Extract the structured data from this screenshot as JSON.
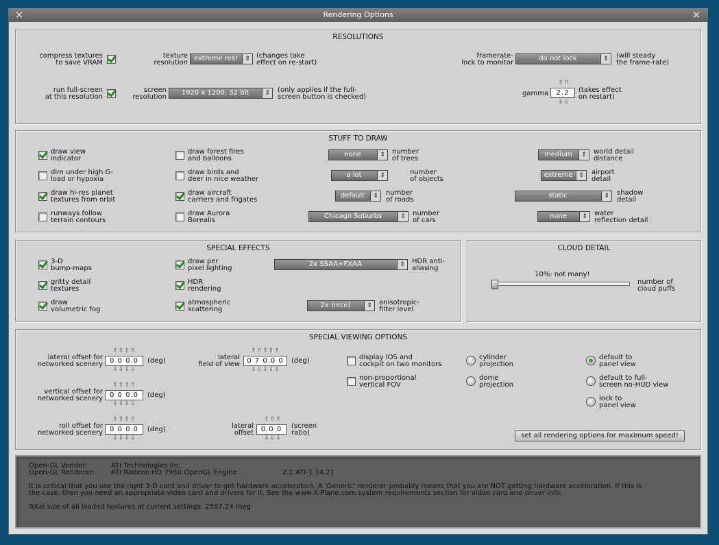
{
  "window": {
    "title": "Rendering Options",
    "close_glyph": "✕"
  },
  "resolutions": {
    "title": "RESOLUTIONS",
    "compress_textures": {
      "label1": "compress textures",
      "label2": "to save VRAM",
      "checked": true
    },
    "texture_resolution": {
      "label1": "texture",
      "label2": "resolution",
      "value": "extreme res!",
      "note1": "(changes take",
      "note2": "effect on re-start)"
    },
    "framerate_lock": {
      "label1": "framerate-",
      "label2": "lock to monitor",
      "value": "do not lock",
      "note1": "(will steady",
      "note2": "the frame-rate)"
    },
    "run_fullscreen": {
      "label1": "run full-screen",
      "label2": "at this resolution",
      "checked": true
    },
    "screen_resolution": {
      "label1": "screen",
      "label2": "resolution",
      "value": "1920 x 1200, 32 bit",
      "note1": "(only applies if the full-",
      "note2": "screen button is checked)"
    },
    "gamma": {
      "label": "gamma",
      "value": "2.2",
      "note1": "(takes effect",
      "note2": "on restart)"
    }
  },
  "stuff": {
    "title": "STUFF TO DRAW",
    "draw_view_indicator": {
      "l1": "draw view",
      "l2": "indicator",
      "checked": true
    },
    "dim_under_g": {
      "l1": "dim under high G-",
      "l2": "load or hypoxia",
      "checked": false
    },
    "draw_hires_planet": {
      "l1": "draw hi-res planet",
      "l2": "textures from orbit",
      "checked": true
    },
    "runways_follow": {
      "l1": "runways follow",
      "l2": "terrain contours",
      "checked": false
    },
    "draw_forest_fires": {
      "l1": "draw forest fires",
      "l2": "and balloons",
      "checked": false
    },
    "draw_birds": {
      "l1": "draw birds and",
      "l2": "deer in nice weather",
      "checked": false
    },
    "draw_carriers": {
      "l1": "draw aircraft",
      "l2": "carriers and frigates",
      "checked": true
    },
    "draw_aurora": {
      "l1": "draw Aurora",
      "l2": "Borealis",
      "checked": false
    },
    "trees": {
      "value": "none",
      "l1": "number",
      "l2": "of trees"
    },
    "objects": {
      "value": "a lot",
      "l1": "number",
      "l2": "of objects"
    },
    "roads": {
      "value": "default",
      "l1": "number",
      "l2": "of roads"
    },
    "cars": {
      "value": "Chicago Suburbs",
      "l1": "number",
      "l2": "of cars"
    },
    "world_detail": {
      "value": "medium",
      "l1": "world detail",
      "l2": "distance"
    },
    "airport_detail": {
      "value": "extreme",
      "l1": "airport",
      "l2": "detail"
    },
    "shadow_detail": {
      "value": "static",
      "l1": "shadow",
      "l2": "detail"
    },
    "water_detail": {
      "value": "none",
      "l1": "water",
      "l2": "reflection detail"
    }
  },
  "effects": {
    "title": "SPECIAL EFFECTS",
    "bump": {
      "l1": "3-D",
      "l2": "bump-maps",
      "checked": true
    },
    "gritty": {
      "l1": "gritty detail",
      "l2": "textures",
      "checked": true
    },
    "fog": {
      "l1": "draw",
      "l2": "volumetric fog",
      "checked": true
    },
    "per_pixel": {
      "l1": "draw per",
      "l2": "pixel lighting",
      "checked": true
    },
    "hdr": {
      "l1": "HDR",
      "l2": "rendering",
      "checked": true
    },
    "atmo": {
      "l1": "atmospheric",
      "l2": "scattering",
      "checked": true
    },
    "aa": {
      "value": "2x SSAA+FXAA",
      "l1": "HDR anti-",
      "l2": "aliasing"
    },
    "aniso": {
      "value": "2x (nice)",
      "l1": "anisotropic-",
      "l2": "filter level"
    }
  },
  "clouds": {
    "title": "CLOUD DETAIL",
    "slider_text": "10%: not many!",
    "slider_value": 0.1,
    "l1": "number of",
    "l2": "cloud puffs"
  },
  "viewing": {
    "title": "SPECIAL VIEWING OPTIONS",
    "lateral_offset": {
      "l1": "lateral offset for",
      "l2": "networked scenery",
      "value": "0 0 0.0",
      "unit": "(deg)"
    },
    "vertical_offset": {
      "l1": "vertical offset for",
      "l2": "networked scenery",
      "value": "0 0 0.0",
      "unit": "(deg)"
    },
    "roll_offset": {
      "l1": "roll offset for",
      "l2": "networked scenery",
      "value": "0 0 0.0",
      "unit": "(deg)"
    },
    "lateral_fov": {
      "l1": "lateral",
      "l2": "field of view",
      "value": "0 7 0.0 0",
      "unit": "(deg)"
    },
    "lateral_screen": {
      "l1": "lateral",
      "l2": "offset",
      "value": "0.0 0",
      "u1": "(screen",
      "u2": "ratio)"
    },
    "ios_two": {
      "l1": "display IOS and",
      "l2": "cockpit on two monitors",
      "checked": false
    },
    "nonprop": {
      "l1": "non-proportional",
      "l2": "vertical FOV",
      "checked": false
    },
    "cylinder": {
      "l1": "cylinder",
      "l2": "projection",
      "selected": false
    },
    "dome": {
      "l1": "dome",
      "l2": "projection",
      "selected": false
    },
    "default_panel": {
      "l1": "default to",
      "l2": "panel view",
      "selected": true
    },
    "default_full": {
      "l1": "default to full-",
      "l2": "screen no-HUD view",
      "selected": false
    },
    "lock_panel": {
      "l1": "lock to",
      "l2": "panel view",
      "selected": false
    },
    "max_speed_button": "set all rendering options for maximum speed!"
  },
  "info": {
    "vendor_label": "Open-GL Vendor:",
    "vendor_value": "ATI Technologies Inc.",
    "renderer_label": "Open-GL Renderer:",
    "renderer_value": "ATI Radeon HD 7950 OpenGL Engine",
    "version": "2.1 ATI-1.14.21",
    "note1": "It is critical that you use the right 3-D card and driver to get hardware acceleration. A 'Generic' renderer probably means that you are NOT getting hardware acceleration. If this is",
    "note2": "the case, then you need an appropriate video card and drivers for it. See the www.X-Plane.com system requirements section for video card and driver info.",
    "texture_size": "Total size of all loaded textures at current settings: 2587.24 meg"
  },
  "colors": {
    "background": "#0e4d73",
    "check_green": "#1a8c1a",
    "info_text": "#bff3ff"
  }
}
